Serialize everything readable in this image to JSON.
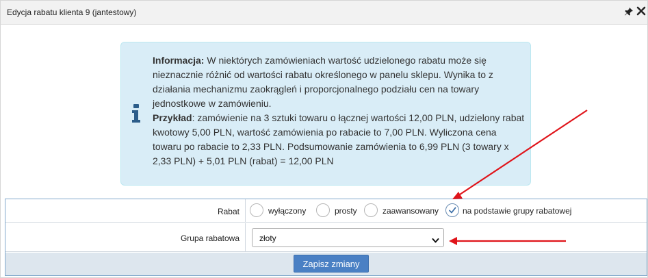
{
  "window": {
    "title": "Edycja rabatu klienta 9 (jantestowy)",
    "icons": [
      "pin-icon",
      "close-icon"
    ]
  },
  "info": {
    "icon": "info-icon",
    "heading": "Informacja:",
    "text": " W niektórych zamówieniach wartość udzielonego rabatu może się nieznacznie różnić od wartości rabatu określonego w panelu sklepu. Wynika to z działania mechanizmu zaokrągleń i proporcjonalnego podziału cen na towary jednostkowe w zamówieniu.",
    "example_heading": "Przykład",
    "example_text": ": zamówienie na 3 sztuki towaru o łącznej wartości 12,00 PLN, udzielony rabat kwotowy 5,00 PLN, wartość zamówienia po rabacie to 7,00 PLN. Wyliczona cena towaru po rabacie to 2,33 PLN. Podsumowanie zamówienia to 6,99 PLN (3 towary x 2,33 PLN) + 5,01 PLN (rabat) = 12,00 PLN"
  },
  "form": {
    "rabat_label": "Rabat",
    "rabat_options": [
      {
        "label": "wyłączony",
        "checked": false
      },
      {
        "label": "prosty",
        "checked": false
      },
      {
        "label": "zaawansowany",
        "checked": false
      },
      {
        "label": "na podstawie grupy rabatowej",
        "checked": true
      }
    ],
    "grupa_label": "Grupa rabatowa",
    "grupa_selected": "złoty",
    "save_label": "Zapisz zmiany"
  },
  "colors": {
    "info_bg": "#d9edf7",
    "info_icon": "#2c5d8a",
    "button": "#4a80c4",
    "arrow": "#e0141a",
    "check": "#3c6fa8"
  }
}
